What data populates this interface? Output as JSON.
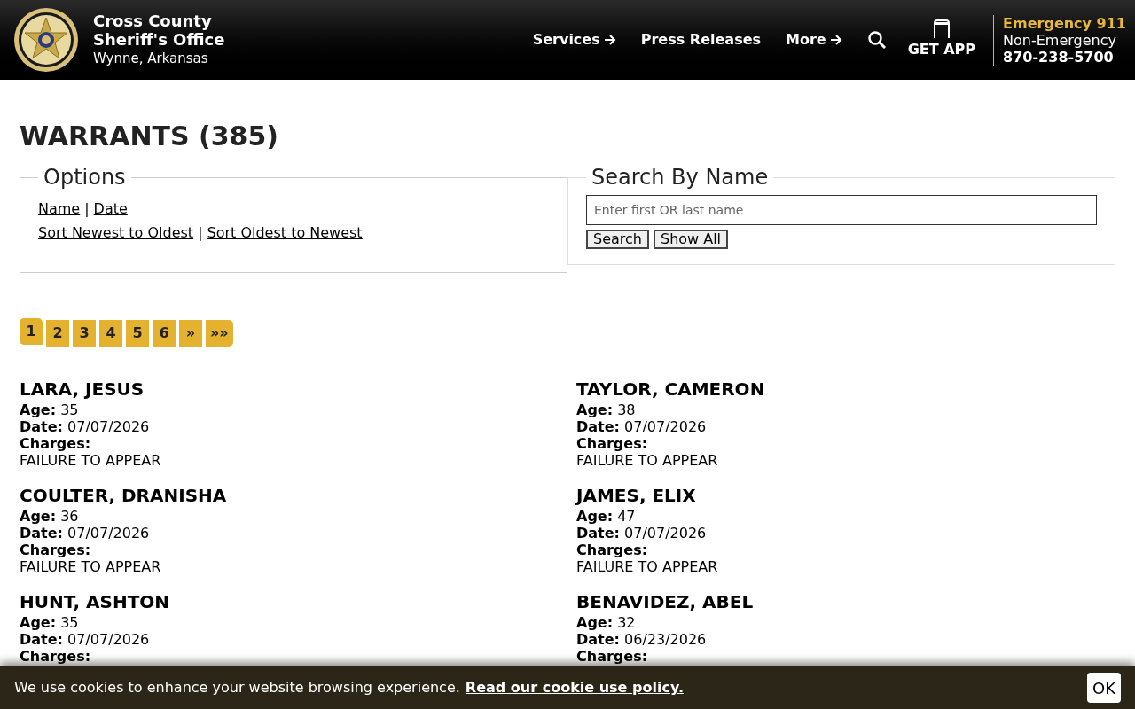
{
  "header": {
    "title_line1": "Cross County",
    "title_line2": "Sheriff's Office",
    "location": "Wynne, Arkansas",
    "nav": [
      {
        "label": "Services",
        "arrow": true
      },
      {
        "label": "Press Releases",
        "arrow": false
      },
      {
        "label": "More",
        "arrow": true
      }
    ],
    "app_label": "GET APP",
    "emergency": "Emergency 911",
    "non_emergency_label": "Non-Emergency",
    "non_emergency_phone": "870-238-5700"
  },
  "page_title": "WARRANTS (385)",
  "options": {
    "legend": "Options",
    "sort_by": [
      "Name",
      "Date"
    ],
    "order": [
      "Sort Newest to Oldest",
      "Sort Oldest to Newest"
    ],
    "separator": "|"
  },
  "search": {
    "legend": "Search By Name",
    "placeholder": "Enter first OR last name",
    "buttons": [
      "Search",
      "Show All"
    ]
  },
  "pagination": [
    {
      "label": "1",
      "selected": true
    },
    {
      "label": "2",
      "selected": false
    },
    {
      "label": "3",
      "selected": false
    },
    {
      "label": "4",
      "selected": false
    },
    {
      "label": "5",
      "selected": false
    },
    {
      "label": "6",
      "selected": false
    },
    {
      "label": "»",
      "selected": false
    },
    {
      "label": "»»",
      "selected": false
    }
  ],
  "warrants": [
    {
      "name": "LARA, JESUS",
      "age_label": "Age:",
      "age": "35",
      "date_label": "Date:",
      "date": "07/07/2026",
      "charges_label": "Charges:",
      "charges": "FAILURE TO APPEAR"
    },
    {
      "name": "TAYLOR, CAMERON",
      "age_label": "Age:",
      "age": "38",
      "date_label": "Date:",
      "date": "07/07/2026",
      "charges_label": "Charges:",
      "charges": "FAILURE TO APPEAR"
    },
    {
      "name": "COULTER, DRANISHA",
      "age_label": "Age:",
      "age": "36",
      "date_label": "Date:",
      "date": "07/07/2026",
      "charges_label": "Charges:",
      "charges": "FAILURE TO APPEAR"
    },
    {
      "name": "JAMES, ELIX",
      "age_label": "Age:",
      "age": "47",
      "date_label": "Date:",
      "date": "07/07/2026",
      "charges_label": "Charges:",
      "charges": "FAILURE TO APPEAR"
    },
    {
      "name": "HUNT, ASHTON",
      "age_label": "Age:",
      "age": "35",
      "date_label": "Date:",
      "date": "07/07/2026",
      "charges_label": "Charges:"
    },
    {
      "name": "BENAVIDEZ, ABEL",
      "age_label": "Age:",
      "age": "32",
      "date_label": "Date:",
      "date": "06/23/2026",
      "charges_label": "Charges:"
    }
  ],
  "cookie": {
    "text": "We use cookies to enhance your website browsing experience.",
    "link": "Read our cookie use policy.",
    "button": "OK"
  }
}
